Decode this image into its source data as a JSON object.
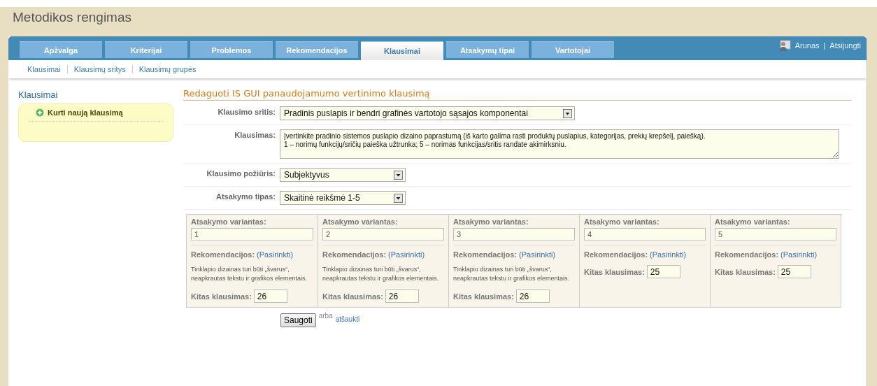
{
  "page_title": "Metodikos rengimas",
  "tabs": [
    {
      "label": "Apžvalga",
      "selected": false
    },
    {
      "label": "Kriterijai",
      "selected": false
    },
    {
      "label": "Problemos",
      "selected": false
    },
    {
      "label": "Rekomendacijos",
      "selected": false
    },
    {
      "label": "Klausimai",
      "selected": true
    },
    {
      "label": "Atsakymų tipai",
      "selected": false
    },
    {
      "label": "Vartotojai",
      "selected": false
    }
  ],
  "user": {
    "name": "Arunas",
    "separator": "|",
    "logout": "Atsijungti"
  },
  "subnav": [
    {
      "label": "Klausimai"
    },
    {
      "label": "Klausimų sritys"
    },
    {
      "label": "Klausimų grupės"
    }
  ],
  "sidebar": {
    "title": "Klausimai",
    "actions": [
      {
        "label": "Kurti naują klausimą"
      }
    ]
  },
  "form": {
    "heading": "Redaguoti IS GUI panaudojamumo vertinimo klausimą",
    "fields": [
      {
        "kind": "select",
        "label": "Klausimo sritis:",
        "value": "Pradinis puslapis ir bendri grafinės vartotojo sąsajos komponentai"
      },
      {
        "kind": "textarea",
        "label": "Klausimas:",
        "value": "Įvertinkite pradinio sistemos puslapio dizaino paprastumą (iš karto galima rasti produktų puslapius, kategorijas, prekių krepšelį, paiešką).\n1 – norimų funkcijų/sričių paieška užtrunka; 5 – norimas funkcijas/sritis randate akimirksniu."
      },
      {
        "kind": "select",
        "label": "Klausimo požiūris:",
        "value": "Subjektyvus"
      },
      {
        "kind": "select",
        "label": "Atsakymo tipas:",
        "value": "Skaitinė reikšmė 1-5"
      }
    ]
  },
  "answers": [
    {
      "label": "Atsakymo variantas:",
      "value": "1",
      "rec_label": "Rekomendacijos:",
      "rec_link": "(Pasirinkti)",
      "rec_text": "Tinklapio dizainas turi būti „švarus“, neapkrautas tekstu ir grafikos elementais.",
      "next_label": "Kitas klausimas:",
      "next_value": "26"
    },
    {
      "label": "Atsakymo variantas:",
      "value": "2",
      "rec_label": "Rekomendacijos:",
      "rec_link": "(Pasirinkti)",
      "rec_text": "Tinklapio dizainas turi būti „švarus“, neapkrautas tekstu ir grafikos elementais.",
      "next_label": "Kitas klausimas:",
      "next_value": "26"
    },
    {
      "label": "Atsakymo variantas:",
      "value": "3",
      "rec_label": "Rekomendacijos:",
      "rec_link": "(Pasirinkti)",
      "rec_text": "Tinklapio dizainas turi būti „švarus“, neapkrautas tekstu ir grafikos elementais.",
      "next_label": "Kitas klausimas:",
      "next_value": "26"
    },
    {
      "label": "Atsakymo variantas:",
      "value": "4",
      "rec_label": "Rekomendacijos:",
      "rec_link": "(Pasirinkti)",
      "next_label": "Kitas klausimas:",
      "next_value": "25"
    },
    {
      "label": "Atsakymo variantas:",
      "value": "5",
      "rec_label": "Rekomendacijos:",
      "rec_link": "(Pasirinkti)",
      "next_label": "Kitas klausimas:",
      "next_value": "25"
    }
  ],
  "buttons": {
    "save": "Saugoti",
    "or": "arba",
    "cancel": "atšaukti"
  }
}
